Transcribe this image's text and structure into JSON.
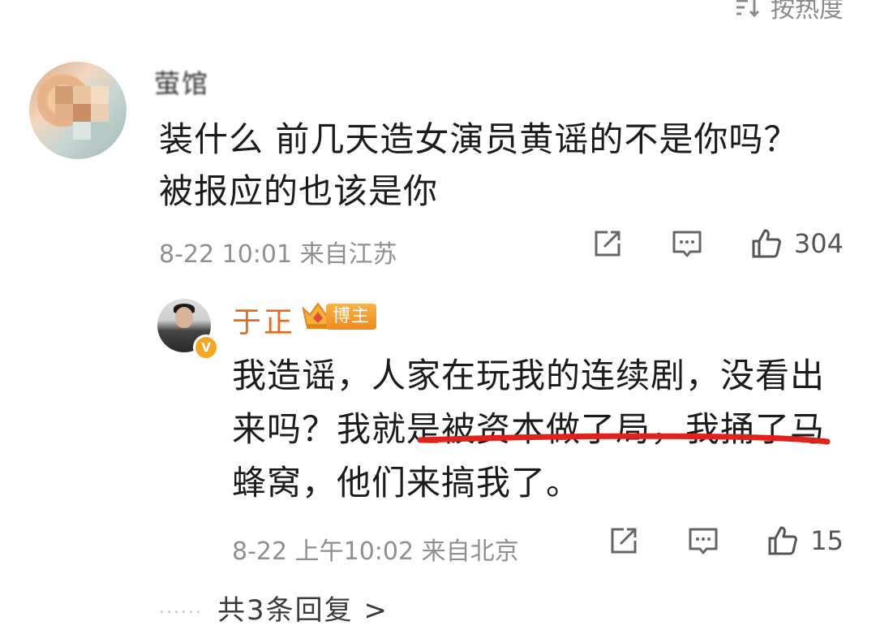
{
  "sort": {
    "label": "按热度",
    "icon": "sort-icon"
  },
  "comment": {
    "username": "萤馆",
    "text": "装什么 前几天造女演员黄谣的不是你吗？被报应的也该是你",
    "timestamp": "8-22 10:01",
    "location": "来自江苏",
    "like_count": "304",
    "icons": [
      "repost-icon",
      "comment-icon",
      "like-icon"
    ]
  },
  "reply": {
    "username": "于正",
    "badge": "博主",
    "verified": "V",
    "text_part1": "我造谣，人家在玩我的连续剧，没看出来吗？",
    "text_highlight": "我就是被资本做了局，",
    "text_part2": "我捅了马蜂窝，他们来搞我了。",
    "timestamp": "8-22 上午10:02",
    "location": "来自北京",
    "like_count": "15",
    "highlight_color": "#e0221d"
  },
  "more_replies": {
    "dots": "......",
    "label": "共3条回复 >"
  }
}
